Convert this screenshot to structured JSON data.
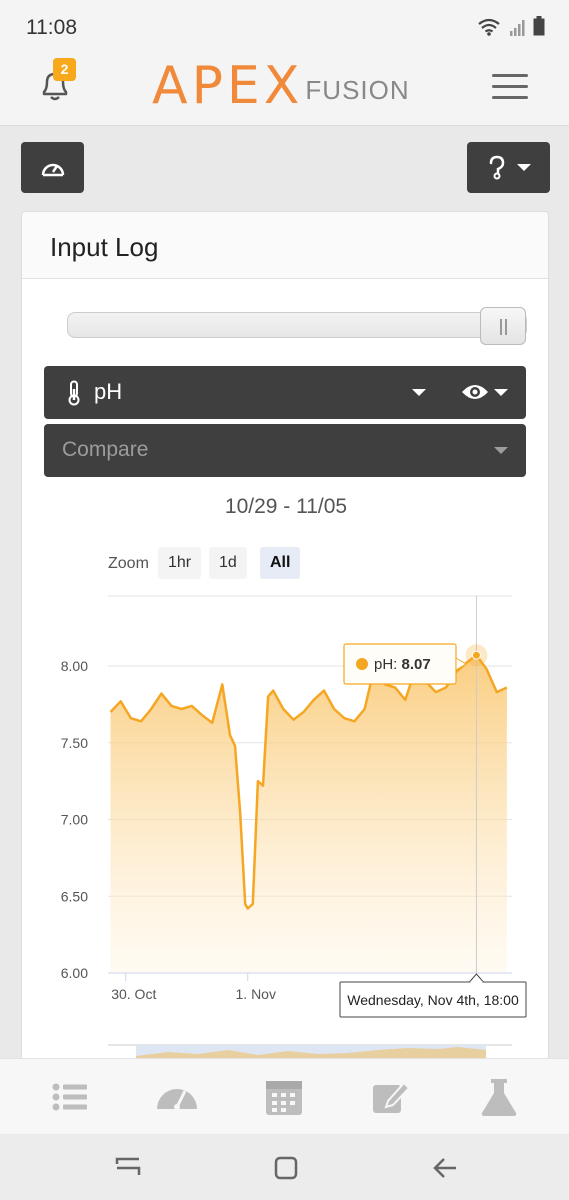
{
  "status_bar": {
    "time": "11:08"
  },
  "header": {
    "notification_count": "2",
    "logo_main": "APEX",
    "logo_sub": "FUSION"
  },
  "card": {
    "title": "Input Log",
    "probe_select": {
      "value": "pH"
    },
    "compare_select": {
      "placeholder": "Compare"
    },
    "date_range": "10/29 - 11/05",
    "zoom": {
      "label": "Zoom",
      "options": [
        "1hr",
        "1d",
        "All"
      ],
      "selected": "All"
    }
  },
  "chart_data": {
    "type": "area",
    "series": [
      {
        "name": "pH",
        "color": "#f5a623",
        "x": [
          "2020-10-29 18:00",
          "2020-10-29 22:00",
          "2020-10-30 02:00",
          "2020-10-30 06:00",
          "2020-10-30 10:00",
          "2020-10-30 14:00",
          "2020-10-30 18:00",
          "2020-10-30 22:00",
          "2020-10-31 02:00",
          "2020-10-31 06:00",
          "2020-10-31 10:00",
          "2020-10-31 14:00",
          "2020-10-31 17:00",
          "2020-10-31 19:00",
          "2020-10-31 21:00",
          "2020-10-31 23:00",
          "2020-11-01 00:00",
          "2020-11-01 02:00",
          "2020-11-01 04:00",
          "2020-11-01 06:00",
          "2020-11-01 08:00",
          "2020-11-01 10:00",
          "2020-11-01 14:00",
          "2020-11-01 18:00",
          "2020-11-01 22:00",
          "2020-11-02 02:00",
          "2020-11-02 06:00",
          "2020-11-02 10:00",
          "2020-11-02 14:00",
          "2020-11-02 18:00",
          "2020-11-02 22:00",
          "2020-11-03 02:00",
          "2020-11-03 06:00",
          "2020-11-03 10:00",
          "2020-11-03 14:00",
          "2020-11-03 18:00",
          "2020-11-03 22:00",
          "2020-11-04 02:00",
          "2020-11-04 06:00",
          "2020-11-04 10:00",
          "2020-11-04 14:00",
          "2020-11-04 18:00",
          "2020-11-04 22:00",
          "2020-11-05 02:00",
          "2020-11-05 06:00"
        ],
        "y": [
          7.7,
          7.77,
          7.66,
          7.64,
          7.72,
          7.82,
          7.74,
          7.72,
          7.74,
          7.68,
          7.63,
          7.88,
          7.55,
          7.48,
          7.05,
          6.45,
          6.42,
          6.45,
          7.25,
          7.22,
          7.8,
          7.84,
          7.72,
          7.65,
          7.7,
          7.78,
          7.84,
          7.72,
          7.66,
          7.64,
          7.72,
          8.0,
          7.88,
          7.86,
          7.78,
          7.98,
          7.9,
          7.83,
          7.86,
          7.96,
          8.02,
          8.07,
          7.98,
          7.83,
          7.86
        ]
      }
    ],
    "y_ticks": [
      "8.00",
      "7.50",
      "7.00",
      "6.50",
      "6.00"
    ],
    "ylim": [
      6.0,
      8.2
    ],
    "x_ticks": [
      "30. Oct",
      "1. Nov"
    ],
    "grid": true,
    "tooltip": {
      "series": "pH",
      "value": "8.07",
      "timestamp": "Wednesday, Nov 4th, 18:00"
    }
  }
}
